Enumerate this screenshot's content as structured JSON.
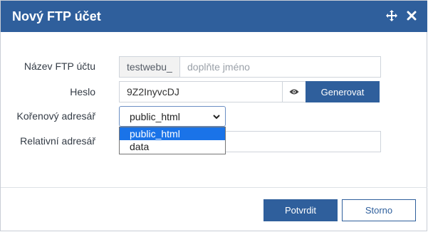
{
  "dialog": {
    "title": "Nový FTP účet",
    "icons": {
      "move": "move-arrows-icon",
      "close": "close-icon"
    }
  },
  "form": {
    "name_label": "Název FTP účtu",
    "name_prefix": "testwebu_",
    "name_placeholder": "doplňte jméno",
    "password_label": "Heslo",
    "password_value": "9Z2InyvcDJ",
    "show_password_icon": "eye-icon",
    "generate_button": "Generovat",
    "root_dir_label": "Kořenový adresář",
    "root_dir_selected": "public_html",
    "root_dir_options": [
      "public_html",
      "data"
    ],
    "relative_dir_label": "Relativní adresář",
    "relative_dir_value": ""
  },
  "footer": {
    "confirm_button": "Potvrdit",
    "cancel_button": "Storno"
  },
  "colors": {
    "brand": "#2f5f9c",
    "highlight": "#1a73e8"
  }
}
